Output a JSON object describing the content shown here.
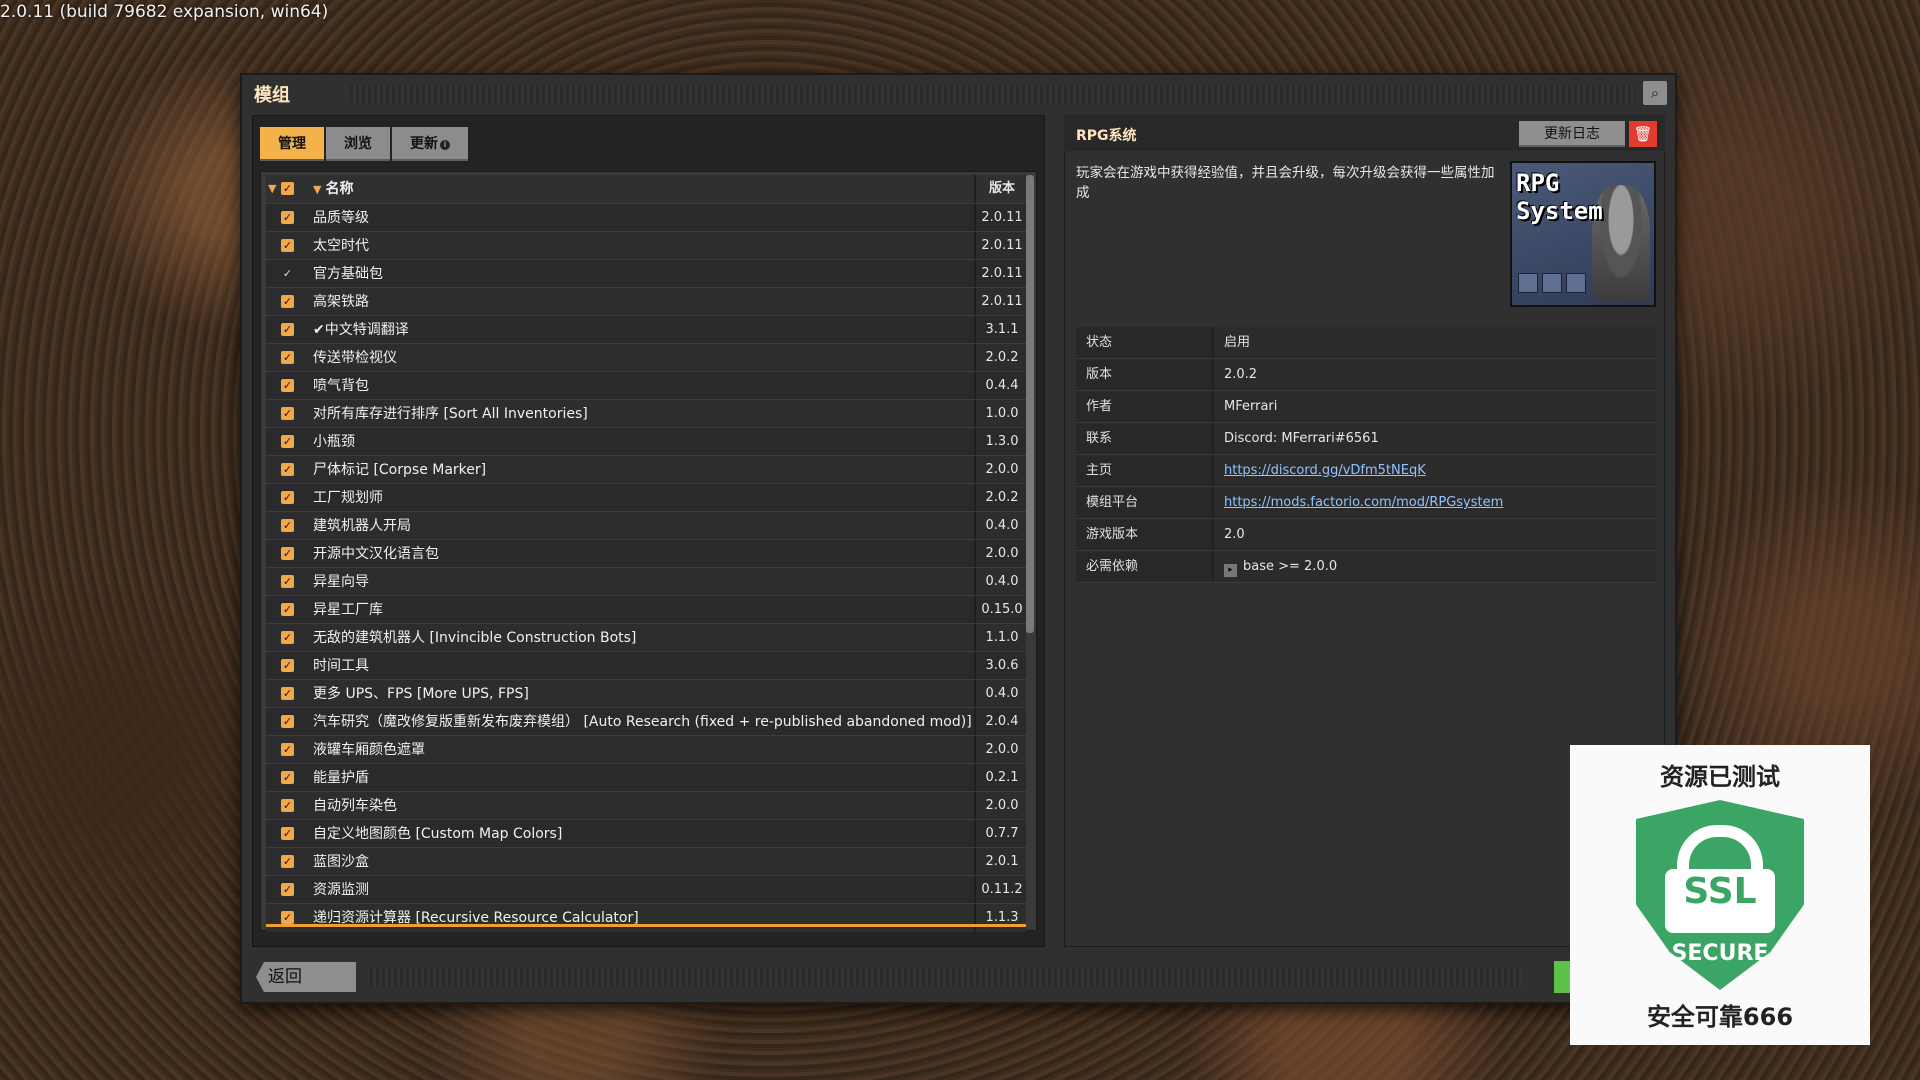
{
  "version_banner": "2.0.11 (build 79682 expansion, win64)",
  "window": {
    "title": "模组"
  },
  "tabs": [
    {
      "label": "管理",
      "active": true
    },
    {
      "label": "浏览",
      "active": false
    },
    {
      "label": "更新",
      "active": false
    }
  ],
  "list": {
    "header_name": "名称",
    "header_version": "版本",
    "mods": [
      {
        "name": "品质等级",
        "version": "2.0.11",
        "checked": true
      },
      {
        "name": "太空时代",
        "version": "2.0.11",
        "checked": true
      },
      {
        "name": "官方基础包",
        "version": "2.0.11",
        "checked": true,
        "locked": true
      },
      {
        "name": "高架铁路",
        "version": "2.0.11",
        "checked": true
      },
      {
        "name": "✔中文特调翻译",
        "version": "3.1.1",
        "checked": true
      },
      {
        "name": "传送带检视仪",
        "version": "2.0.2",
        "checked": true
      },
      {
        "name": "喷气背包",
        "version": "0.4.4",
        "checked": true
      },
      {
        "name": "对所有库存进行排序 [Sort All Inventories]",
        "version": "1.0.0",
        "checked": true
      },
      {
        "name": "小瓶颈",
        "version": "1.3.0",
        "checked": true
      },
      {
        "name": "尸体标记 [Corpse Marker]",
        "version": "2.0.0",
        "checked": true
      },
      {
        "name": "工厂规划师",
        "version": "2.0.2",
        "checked": true
      },
      {
        "name": "建筑机器人开局",
        "version": "0.4.0",
        "checked": true
      },
      {
        "name": "开源中文汉化语言包",
        "version": "2.0.0",
        "checked": true
      },
      {
        "name": "异星向导",
        "version": "0.4.0",
        "checked": true
      },
      {
        "name": "异星工厂库",
        "version": "0.15.0",
        "checked": true
      },
      {
        "name": "无敌的建筑机器人 [Invincible Construction Bots]",
        "version": "1.1.0",
        "checked": true
      },
      {
        "name": "时间工具",
        "version": "3.0.6",
        "checked": true
      },
      {
        "name": "更多 UPS、FPS [More UPS, FPS]",
        "version": "0.4.0",
        "checked": true
      },
      {
        "name": "汽车研究（魔改修复版重新发布废弃模组） [Auto Research (fixed + re-published abandoned mod)]",
        "version": "2.0.4",
        "checked": true
      },
      {
        "name": "液罐车厢颜色遮罩",
        "version": "2.0.0",
        "checked": true
      },
      {
        "name": "能量护盾",
        "version": "0.2.1",
        "checked": true
      },
      {
        "name": "自动列车染色",
        "version": "2.0.0",
        "checked": true
      },
      {
        "name": "自定义地图颜色 [Custom Map Colors]",
        "version": "0.7.7",
        "checked": true
      },
      {
        "name": "蓝图沙盒",
        "version": "2.0.1",
        "checked": true
      },
      {
        "name": "资源监测",
        "version": "0.11.2",
        "checked": true
      },
      {
        "name": "递归资源计算器 [Recursive Resource Calculator]",
        "version": "1.1.3",
        "checked": true
      }
    ]
  },
  "detail": {
    "title": "RPG系统",
    "changelog_label": "更新日志",
    "description": "玩家会在游戏中获得经验值，并且会升级，每次升级会获得一些属性加成",
    "thumbnail_text": "RPG System",
    "info": [
      {
        "key": "状态",
        "value": "启用"
      },
      {
        "key": "版本",
        "value": "2.0.2"
      },
      {
        "key": "作者",
        "value": "MFerrari"
      },
      {
        "key": "联系",
        "value": "Discord: MFerrari#6561"
      },
      {
        "key": "主页",
        "value": "https://discord.gg/vDfm5tNEqK",
        "link": true
      },
      {
        "key": "模组平台",
        "value": "https://mods.factorio.com/mod/RPGsystem",
        "link": true
      },
      {
        "key": "游戏版本",
        "value": "2.0"
      },
      {
        "key": "必需依赖",
        "value": "base >= 2.0.0",
        "dependency": true
      }
    ]
  },
  "footer": {
    "back_label": "返回"
  },
  "overlay": {
    "top_text": "资源已测试",
    "ssl_text": "SSL",
    "secure_text": "SECURE",
    "bottom_text": "安全可靠666"
  },
  "colors": {
    "accent_orange": "#f4b24a",
    "link_blue": "#8ec4ff",
    "delete_red": "#e23a2e",
    "ssl_green": "#3aa564"
  }
}
